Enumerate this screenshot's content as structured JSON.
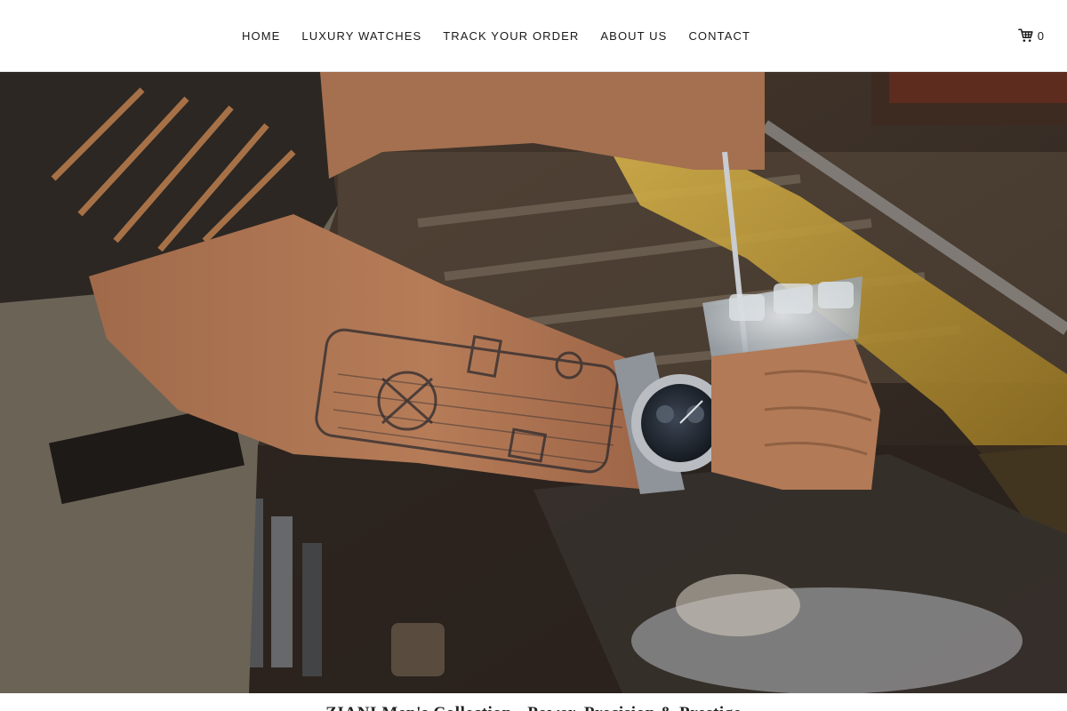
{
  "nav": {
    "items": [
      {
        "label": "HOME"
      },
      {
        "label": "LUXURY WATCHES"
      },
      {
        "label": "TRACK YOUR ORDER"
      },
      {
        "label": "ABOUT US"
      },
      {
        "label": "CONTACT"
      }
    ]
  },
  "cart": {
    "icon": "shopping-cart-icon",
    "count": "0"
  },
  "hero": {
    "image_subject": "tattooed forearm wearing a silver chronograph watch, holding a glass of ice at a bar"
  },
  "section": {
    "title": "ZIANI Men's Collection - Power, Precision & Prestige"
  },
  "colors": {
    "header_bg": "#ffffff",
    "nav_text": "#1a1a1a",
    "hero_dark": "#2a2420",
    "accent_gold": "#c9a23a"
  }
}
